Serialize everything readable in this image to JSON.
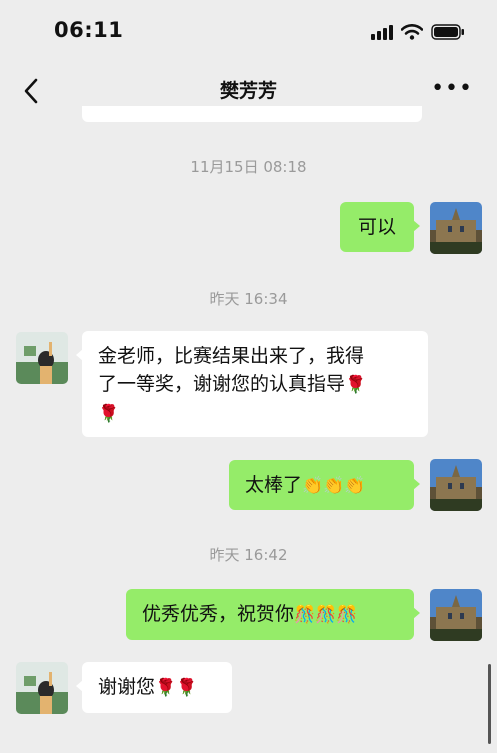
{
  "status_bar": {
    "time": "06:11"
  },
  "nav": {
    "back_icon": "chevron-left-icon",
    "title": "樊芳芳",
    "more_icon": "ellipsis-icon",
    "more_label": "•••"
  },
  "messages": {
    "ts1": "11月15日 08:18",
    "m1": {
      "text": "可以"
    },
    "ts2": "昨天 16:34",
    "m2": {
      "line1": "金老师，比赛结果出来了，我得",
      "line2": "了一等奖，谢谢您的认真指导",
      "emoji_a": "🌹",
      "emoji_b": "🌹"
    },
    "m3": {
      "text": "太棒了",
      "emoji": "👏👏👏"
    },
    "ts3": "昨天 16:42",
    "m4": {
      "text": "优秀优秀，祝贺你",
      "emoji": "🎊🎊🎊"
    },
    "m5": {
      "text": "谢谢您",
      "emoji": "🌹🌹"
    }
  },
  "colors": {
    "background": "#ededed",
    "outgoing_bubble": "#95ec69",
    "incoming_bubble": "#ffffff",
    "timestamp": "#9a9a9a"
  }
}
